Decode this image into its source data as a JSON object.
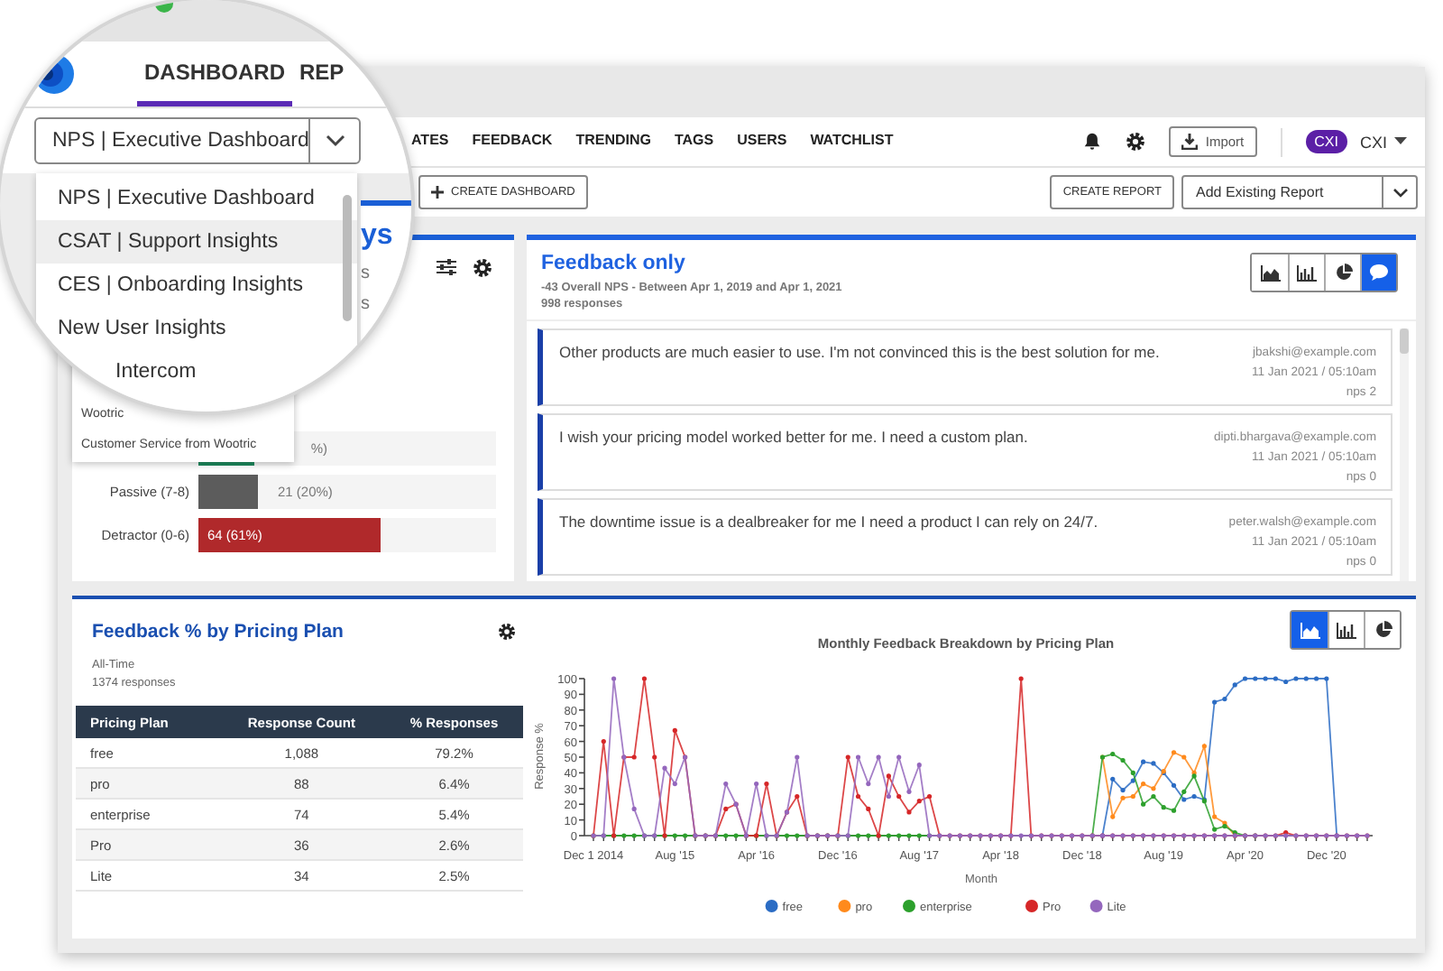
{
  "magnifier": {
    "nav_tabs": [
      {
        "label": "DASHBOARD",
        "selected": true
      },
      {
        "label": "REP",
        "selected": false
      }
    ],
    "dashboard_select": {
      "value": "NPS | Executive Dashboard"
    },
    "dashboard_menu": [
      {
        "label": "NPS | Executive Dashboard",
        "selected": false
      },
      {
        "label": "CSAT | Support Insights",
        "selected": true
      },
      {
        "label": "CES | Onboarding Insights",
        "selected": false
      },
      {
        "label": "New User Insights",
        "selected": false
      },
      {
        "label": "Intercom",
        "selected": false
      }
    ],
    "panel_title": "ys",
    "panel_lines": [
      "s",
      "s"
    ]
  },
  "nav_tabs": [
    {
      "label": "ATES",
      "selected": false
    },
    {
      "label": "FEEDBACK",
      "selected": false
    },
    {
      "label": "TRENDING",
      "selected": false
    },
    {
      "label": "TAGS",
      "selected": false
    },
    {
      "label": "USERS",
      "selected": false
    },
    {
      "label": "WATCHLIST",
      "selected": false
    }
  ],
  "import_button": "Import",
  "account": {
    "badge": "CXI",
    "name": "CXI"
  },
  "toolbar": {
    "create_dashboard": "CREATE DASHBOARD",
    "create_report": "CREATE REPORT",
    "report_select": {
      "value": "Add Existing Report"
    }
  },
  "dashboard_menu_tail": [
    "Wootric",
    "Customer Service from Wootric"
  ],
  "nps_panel": {
    "rows": [
      {
        "kind": "partial",
        "level": 0.19,
        "reading": "%)",
        "color": "#1e8a5e"
      },
      {
        "kind": "outside",
        "label": "Passive (7-8)",
        "level": 0.2,
        "reading": "21 (20%)",
        "color": "#5c5c5c"
      },
      {
        "kind": "inside",
        "label": "Detractor (0-6)",
        "level": 0.61,
        "reading": "64 (61%)",
        "color": "#b0292b"
      }
    ]
  },
  "feedback_panel": {
    "title": "Feedback only",
    "subtitle": "-43 Overall NPS - Between Apr 1, 2019 and Apr 1, 2021",
    "count": "998 responses",
    "view_buttons": [
      {
        "kind": "area",
        "selected": false
      },
      {
        "kind": "bar",
        "selected": false
      },
      {
        "kind": "pie",
        "selected": false
      },
      {
        "kind": "comments",
        "selected": true
      }
    ],
    "responses": [
      {
        "text": "Other products are much easier to use. I'm not convinced this is the best solution for me.",
        "email": "jbakshi@example.com",
        "date": "11 Jan 2021 / 05:10am",
        "score": "nps 2"
      },
      {
        "text": "I wish your pricing model worked better for me. I need a custom plan.",
        "email": "dipti.bhargava@example.com",
        "date": "11 Jan 2021 / 05:10am",
        "score": "nps 0"
      },
      {
        "text": "The downtime issue is a dealbreaker for me I need a product I can rely on 24/7.",
        "email": "peter.walsh@example.com",
        "date": "11 Jan 2021 / 05:10am",
        "score": "nps 0"
      }
    ]
  },
  "pricing_panel": {
    "title": "Feedback % by Pricing Plan",
    "period": "All-Time",
    "count": "1374 responses",
    "table": {
      "columns": [
        "Pricing Plan",
        "Response Count",
        "% Responses"
      ],
      "rows": [
        [
          "free",
          "1,088",
          "79.2%"
        ],
        [
          "pro",
          "88",
          "6.4%"
        ],
        [
          "enterprise",
          "74",
          "5.4%"
        ],
        [
          "Pro",
          "36",
          "2.6%"
        ],
        [
          "Lite",
          "34",
          "2.5%"
        ]
      ]
    },
    "view_buttons": [
      {
        "kind": "area",
        "selected": true
      },
      {
        "kind": "bar",
        "selected": false
      },
      {
        "kind": "pie",
        "selected": false
      }
    ],
    "chart_data": {
      "type": "line",
      "title": "Monthly Feedback Breakdown by Pricing Plan",
      "xlabel": "Month",
      "ylabel": "Response %",
      "categories": [
        "Dec 1 2014",
        null,
        null,
        null,
        null,
        null,
        null,
        null,
        "Aug '15",
        null,
        null,
        null,
        null,
        null,
        null,
        null,
        "Apr '16",
        null,
        null,
        null,
        null,
        null,
        null,
        null,
        "Dec '16",
        null,
        null,
        null,
        null,
        null,
        null,
        null,
        "Aug '17",
        null,
        null,
        null,
        null,
        null,
        null,
        null,
        "Apr '18",
        null,
        null,
        null,
        null,
        null,
        null,
        null,
        "Dec '18",
        null,
        null,
        null,
        null,
        null,
        null,
        null,
        "Aug '19",
        null,
        null,
        null,
        null,
        null,
        null,
        null,
        "Apr '20",
        null,
        null,
        null,
        null,
        null,
        null,
        null,
        "Dec '20",
        null,
        null,
        null,
        null
      ],
      "ylim": [
        0,
        100
      ],
      "legend": "bottom",
      "yticks": [
        0,
        10,
        20,
        30,
        40,
        50,
        60,
        70,
        80,
        90,
        100
      ],
      "series": [
        {
          "name": "free",
          "color": "#2b6cc4",
          "values": [
            null,
            null,
            null,
            null,
            null,
            null,
            null,
            null,
            null,
            null,
            null,
            null,
            null,
            null,
            null,
            null,
            null,
            null,
            null,
            null,
            null,
            null,
            null,
            null,
            null,
            null,
            null,
            null,
            null,
            null,
            null,
            null,
            null,
            null,
            null,
            null,
            null,
            null,
            null,
            null,
            null,
            null,
            null,
            null,
            null,
            null,
            null,
            null,
            null,
            null,
            0,
            36,
            29,
            35,
            47,
            46,
            40,
            32,
            23,
            25,
            23,
            85,
            87,
            96,
            100,
            100,
            100,
            100,
            98,
            100,
            100,
            100,
            100,
            0,
            null,
            null,
            null
          ]
        },
        {
          "name": "pro",
          "color": "#ff8a1c",
          "values": [
            null,
            null,
            null,
            null,
            null,
            null,
            null,
            null,
            null,
            null,
            null,
            null,
            null,
            null,
            null,
            null,
            null,
            null,
            null,
            null,
            null,
            null,
            null,
            null,
            null,
            null,
            null,
            null,
            null,
            null,
            null,
            null,
            null,
            null,
            null,
            null,
            null,
            null,
            null,
            null,
            null,
            null,
            null,
            null,
            null,
            null,
            null,
            null,
            null,
            null,
            50,
            12,
            24,
            25,
            33,
            30,
            41,
            53,
            50,
            40,
            57,
            12,
            8,
            0,
            null,
            null,
            null,
            null,
            null,
            null,
            null,
            null,
            null,
            null,
            null,
            null,
            null
          ]
        },
        {
          "name": "enterprise",
          "color": "#2ca02c",
          "values": [
            0,
            0,
            0,
            0,
            0,
            0,
            0,
            0,
            0,
            0,
            0,
            0,
            0,
            0,
            0,
            0,
            0,
            0,
            0,
            0,
            0,
            0,
            0,
            0,
            0,
            0,
            0,
            0,
            0,
            0,
            0,
            0,
            0,
            0,
            null,
            null,
            null,
            null,
            null,
            null,
            null,
            null,
            null,
            null,
            null,
            null,
            null,
            null,
            null,
            0,
            50,
            52,
            48,
            40,
            20,
            25,
            18,
            16,
            28,
            38,
            22,
            4,
            6,
            2,
            0,
            0,
            null,
            null,
            null,
            null,
            null,
            null,
            null,
            null,
            null,
            null,
            null
          ]
        },
        {
          "name": "Pro",
          "color": "#d62728",
          "values": [
            0,
            60,
            0,
            50,
            50,
            100,
            50,
            0,
            67,
            50,
            0,
            0,
            0,
            17,
            20,
            0,
            0,
            33,
            0,
            15,
            25,
            0,
            0,
            0,
            0,
            50,
            25,
            17,
            0,
            38,
            25,
            15,
            22,
            25,
            0,
            0,
            0,
            0,
            0,
            0,
            0,
            0,
            100,
            0,
            0,
            0,
            0,
            0,
            0,
            0,
            0,
            0,
            0,
            0,
            0,
            0,
            0,
            0,
            0,
            0,
            0,
            0,
            0,
            0,
            0,
            0,
            0,
            0,
            2,
            0,
            0,
            0,
            0,
            0,
            0,
            0,
            0
          ]
        },
        {
          "name": "Lite",
          "color": "#9467bd",
          "values": [
            0,
            0,
            100,
            50,
            17,
            0,
            0,
            43,
            33,
            50,
            0,
            0,
            0,
            33,
            20,
            0,
            33,
            0,
            0,
            15,
            50,
            0,
            0,
            0,
            0,
            0,
            50,
            33,
            50,
            25,
            50,
            28,
            45,
            0,
            0,
            0,
            0,
            0,
            0,
            0,
            0,
            0,
            0,
            0,
            0,
            0,
            0,
            0,
            0,
            0,
            0,
            0,
            0,
            0,
            0,
            0,
            0,
            0,
            0,
            0,
            0,
            0,
            0,
            0,
            0,
            0,
            0,
            0,
            0,
            0,
            0,
            0,
            0,
            0,
            0,
            0,
            0
          ]
        }
      ]
    }
  }
}
